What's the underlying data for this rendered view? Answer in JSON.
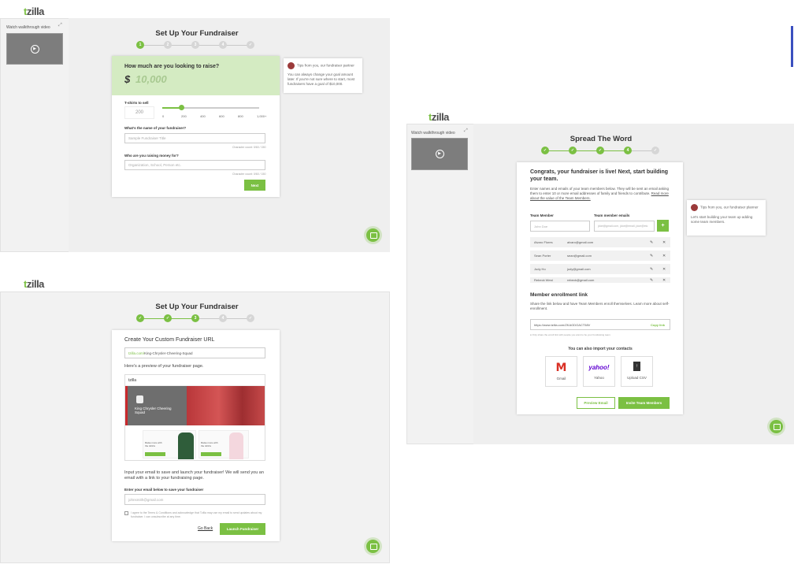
{
  "brand": {
    "logo_t": "t",
    "logo_rest": "zilla",
    "green": "#7bc043"
  },
  "sidebar": {
    "walkthrough": "Watch walkthrough video",
    "expand_icon": "expand-icon"
  },
  "step1": {
    "title": "Set Up Your Fundraiser",
    "steps": [
      "1",
      "2",
      "3",
      "4",
      "5"
    ],
    "raise_question": "How much are you looking to raise?",
    "currency": "$",
    "goal_placeholder": "10,000",
    "tip_header": "Tips from you, our fundraiser partner",
    "tip_body": "You can always change your goal amount later. If you're not sure where to start, most fundraisers have a goal of $10,000.",
    "tshirts_label": "T-shirts to sell",
    "tshirts_value": "200",
    "slider_ticks": [
      "0",
      "200",
      "400",
      "600",
      "800",
      "1,000+"
    ],
    "slider_fraction": 0.2,
    "name_label": "What's the name of your fundraiser?",
    "name_placeholder": "Sample Fundraiser Title",
    "char_count_1": "Character count: 0/60 / 150",
    "reason_label": "Who are you raising money for?",
    "reason_placeholder": "Organization, School, Person etc.",
    "char_count_2": "Character count: 0/60 / 150",
    "next": "Next"
  },
  "step3": {
    "title": "Set Up Your Fundraiser",
    "heading": "Create Your Custom Fundraiser URL",
    "url_prefix": "tzilla.com/",
    "url_value": "King-Chrysler-Cheering-Squad",
    "preview_label": "Here's a preview of your fundraiser page.",
    "preview_logo": "tzilla",
    "preview_name": "King Chrysler Cheering Squad",
    "preview_cta_1": "Raise more with the tshirts",
    "preview_cta_2": "Raise more with the tshirts",
    "input_text": "Input your email to save and launch your fundraiser! We will send you an email with a link to your fundraising page.",
    "email_label": "Enter your email below to save your fundraiser",
    "email_placeholder": "johnsmith@gmail.com",
    "terms_text": "I agree to the Terms & Conditions and acknowledge that Tzilla may use my email to send updates about my fundraiser. I can unsubscribe at any time.",
    "go_back": "Go Back",
    "launch": "Launch Fundraiser"
  },
  "step5": {
    "title": "Spread The Word",
    "congrats": "Congrats, your fundraiser is live! Next, start building your team.",
    "intro": "Enter names and emails of your team members below. They will be sent an email asking them to enter 10 or more email addresses of family and friends to contribute.",
    "read_more": "Read more about the value of the Team Members.",
    "col_member": "Team Member",
    "col_email": "Team member emails",
    "member_placeholder": "John Doe",
    "email_placeholder": "jdoe@gmail.com, jdoe@email, jdoe@etc",
    "rows": [
      {
        "name": "Alvaro Flores",
        "email": "alvaro@gmail.com"
      },
      {
        "name": "Sean Porter",
        "email": "sean@gmail.com"
      },
      {
        "name": "Judy Ho",
        "email": "judy@gmail.com"
      },
      {
        "name": "Rebeck West",
        "email": "rebeck@gmail.com"
      }
    ],
    "enroll_title": "Member enrollment link",
    "enroll_text": "Share the link below and have Team Members enroll themselves. Learn more about self-enrollment.",
    "enroll_url": "https://www.tzilla.com/ZKAGDOACT58V",
    "copy_link": "Copy link",
    "enroll_note": "Only share the enroll link with people you want to be your fundraising team.",
    "import_label": "You can also import your contacts",
    "services": [
      {
        "name": "Gmail",
        "icon": "gmail-icon"
      },
      {
        "name": "Yahoo",
        "icon": "yahoo-icon"
      },
      {
        "name": "Upload CSV",
        "icon": "upload-icon"
      }
    ],
    "preview_email": "Preview Email",
    "invite": "Invite Team Members",
    "tip_header": "Tips from you, our fundraiser planner",
    "tip_body": "Let's start building your team up adding some team members."
  }
}
